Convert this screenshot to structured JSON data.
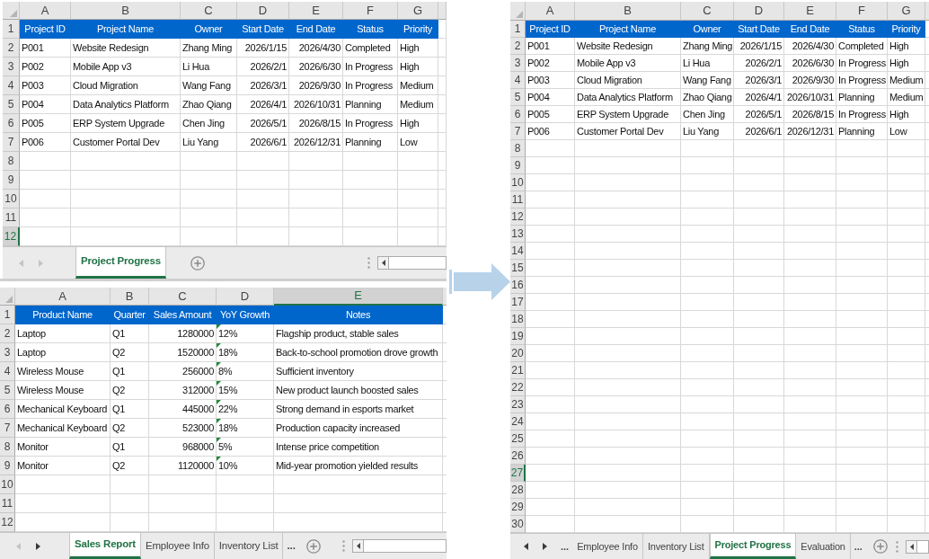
{
  "left_panels": [
    {
      "columns": [
        {
          "label": "A",
          "kind": "text",
          "selected": false
        },
        {
          "label": "B",
          "kind": "text",
          "selected": false
        },
        {
          "label": "C",
          "kind": "text",
          "selected": false
        },
        {
          "label": "D",
          "kind": "number",
          "selected": false
        },
        {
          "label": "E",
          "kind": "number",
          "selected": false
        },
        {
          "label": "F",
          "kind": "text",
          "selected": false
        },
        {
          "label": "G",
          "kind": "text",
          "selected": false
        }
      ],
      "rows": [
        {
          "label": "1",
          "kind": "header",
          "selected": false,
          "cells": [
            "Project ID",
            "Project Name",
            "Owner",
            "Start Date",
            "End Date",
            "Status",
            "Priority"
          ]
        },
        {
          "label": "2",
          "kind": "data",
          "selected": false,
          "cells": [
            "P001",
            "Website Redesign",
            "Zhang Ming",
            "2026/1/15",
            "2026/4/30",
            "Completed",
            "High"
          ]
        },
        {
          "label": "3",
          "kind": "data",
          "selected": false,
          "cells": [
            "P002",
            "Mobile App v3",
            "Li Hua",
            "2026/2/1",
            "2026/6/30",
            "In Progress",
            "High"
          ]
        },
        {
          "label": "4",
          "kind": "data",
          "selected": false,
          "cells": [
            "P003",
            "Cloud Migration",
            "Wang Fang",
            "2026/3/1",
            "2026/9/30",
            "In Progress",
            "Medium"
          ]
        },
        {
          "label": "5",
          "kind": "data",
          "selected": false,
          "cells": [
            "P004",
            "Data Analytics Platform",
            "Zhao Qiang",
            "2026/4/1",
            "2026/10/31",
            "Planning",
            "Medium"
          ]
        },
        {
          "label": "6",
          "kind": "data",
          "selected": false,
          "cells": [
            "P005",
            "ERP System Upgrade",
            "Chen Jing",
            "2026/5/1",
            "2026/8/15",
            "In Progress",
            "High"
          ]
        },
        {
          "label": "7",
          "kind": "data",
          "selected": false,
          "cells": [
            "P006",
            "Customer Portal Dev",
            "Liu Yang",
            "2026/6/1",
            "2026/12/31",
            "Planning",
            "Low"
          ]
        },
        {
          "label": "8",
          "kind": "data",
          "selected": false
        },
        {
          "label": "9",
          "kind": "data",
          "selected": false
        },
        {
          "label": "10",
          "kind": "data",
          "selected": false
        },
        {
          "label": "11",
          "kind": "data",
          "selected": false
        },
        {
          "label": "12",
          "kind": "data",
          "selected": true
        }
      ],
      "tab_bar": {
        "scroll_left": {
          "disabled": true
        },
        "scroll_right": {
          "disabled": true
        },
        "items": [
          {
            "kind": "tab",
            "label": "Project Progress",
            "selected": true
          }
        ]
      }
    },
    {
      "columns": [
        {
          "label": "A",
          "kind": "text",
          "selected": false
        },
        {
          "label": "B",
          "kind": "text",
          "selected": false
        },
        {
          "label": "C",
          "kind": "number",
          "selected": false
        },
        {
          "label": "D",
          "kind": "text",
          "selected": false
        },
        {
          "label": "E",
          "kind": "text",
          "selected": true
        }
      ],
      "rows": [
        {
          "label": "1",
          "kind": "header",
          "selected": false,
          "cells": [
            "Product Name",
            "Quarter",
            "Sales Amount",
            "YoY Growth",
            "Notes"
          ]
        },
        {
          "label": "2",
          "kind": "data",
          "selected": false,
          "cells": [
            "Laptop",
            "Q1",
            "1280000",
            {
              "text": "12%",
              "flagged": true
            },
            "Flagship product, stable sales"
          ]
        },
        {
          "label": "3",
          "kind": "data",
          "selected": false,
          "cells": [
            "Laptop",
            "Q2",
            "1520000",
            {
              "text": "18%",
              "flagged": true
            },
            "Back-to-school promotion drove growth"
          ]
        },
        {
          "label": "4",
          "kind": "data",
          "selected": false,
          "cells": [
            "Wireless Mouse",
            "Q1",
            "256000",
            {
              "text": "8%",
              "flagged": true
            },
            "Sufficient inventory"
          ]
        },
        {
          "label": "5",
          "kind": "data",
          "selected": false,
          "cells": [
            "Wireless Mouse",
            "Q2",
            "312000",
            {
              "text": "15%",
              "flagged": true
            },
            "New product launch boosted sales"
          ]
        },
        {
          "label": "6",
          "kind": "data",
          "selected": false,
          "cells": [
            "Mechanical Keyboard",
            "Q1",
            "445000",
            {
              "text": "22%",
              "flagged": true
            },
            "Strong demand in esports market"
          ]
        },
        {
          "label": "7",
          "kind": "data",
          "selected": false,
          "cells": [
            "Mechanical Keyboard",
            "Q2",
            "523000",
            {
              "text": "18%",
              "flagged": true
            },
            "Production capacity increased"
          ]
        },
        {
          "label": "8",
          "kind": "data",
          "selected": false,
          "cells": [
            "Monitor",
            "Q1",
            "968000",
            {
              "text": "5%",
              "flagged": true
            },
            "Intense price competition"
          ]
        },
        {
          "label": "9",
          "kind": "data",
          "selected": false,
          "cells": [
            "Monitor",
            "Q2",
            "1120000",
            {
              "text": "10%",
              "flagged": true
            },
            "Mid-year promotion yielded results"
          ]
        },
        {
          "label": "10",
          "kind": "data",
          "selected": false
        },
        {
          "label": "11",
          "kind": "data",
          "selected": false
        },
        {
          "label": "12",
          "kind": "data",
          "selected": false
        }
      ],
      "tab_bar": {
        "scroll_left": {
          "disabled": true
        },
        "scroll_right": {
          "disabled": false
        },
        "items": [
          {
            "kind": "tab",
            "label": "Sales Report",
            "selected": true
          },
          {
            "kind": "tab",
            "label": "Employee Info",
            "selected": false
          },
          {
            "kind": "tab",
            "label": "Inventory List",
            "selected": false
          },
          {
            "kind": "more",
            "label": "...",
            "selected": false
          }
        ]
      }
    }
  ],
  "right_panel": {
    "columns": [
      {
        "label": "A",
        "kind": "text",
        "selected": false
      },
      {
        "label": "B",
        "kind": "text",
        "selected": false
      },
      {
        "label": "C",
        "kind": "text",
        "selected": false
      },
      {
        "label": "D",
        "kind": "number",
        "selected": false
      },
      {
        "label": "E",
        "kind": "number",
        "selected": false
      },
      {
        "label": "F",
        "kind": "text",
        "selected": false
      },
      {
        "label": "G",
        "kind": "text",
        "selected": false
      }
    ],
    "rows": [
      {
        "label": "1",
        "kind": "header",
        "selected": false,
        "cells": [
          "Project ID",
          "Project Name",
          "Owner",
          "Start Date",
          "End Date",
          "Status",
          "Priority"
        ]
      },
      {
        "label": "2",
        "kind": "data",
        "selected": false,
        "cells": [
          "P001",
          "Website Redesign",
          "Zhang Ming",
          "2026/1/15",
          "2026/4/30",
          "Completed",
          "High"
        ]
      },
      {
        "label": "3",
        "kind": "data",
        "selected": false,
        "cells": [
          "P002",
          "Mobile App v3",
          "Li Hua",
          "2026/2/1",
          "2026/6/30",
          "In Progress",
          "High"
        ]
      },
      {
        "label": "4",
        "kind": "data",
        "selected": false,
        "cells": [
          "P003",
          "Cloud Migration",
          "Wang Fang",
          "2026/3/1",
          "2026/9/30",
          "In Progress",
          "Medium"
        ]
      },
      {
        "label": "5",
        "kind": "data",
        "selected": false,
        "cells": [
          "P004",
          "Data Analytics Platform",
          "Zhao Qiang",
          "2026/4/1",
          "2026/10/31",
          "Planning",
          "Medium"
        ]
      },
      {
        "label": "6",
        "kind": "data",
        "selected": false,
        "cells": [
          "P005",
          "ERP System Upgrade",
          "Chen Jing",
          "2026/5/1",
          "2026/8/15",
          "In Progress",
          "High"
        ]
      },
      {
        "label": "7",
        "kind": "data",
        "selected": false,
        "cells": [
          "P006",
          "Customer Portal Dev",
          "Liu Yang",
          "2026/6/1",
          "2026/12/31",
          "Planning",
          "Low"
        ]
      },
      {
        "label": "8",
        "kind": "data",
        "selected": false
      },
      {
        "label": "9",
        "kind": "data",
        "selected": false
      },
      {
        "label": "10",
        "kind": "data",
        "selected": false
      },
      {
        "label": "11",
        "kind": "data",
        "selected": false
      },
      {
        "label": "12",
        "kind": "data",
        "selected": false
      },
      {
        "label": "13",
        "kind": "data",
        "selected": false
      },
      {
        "label": "14",
        "kind": "data",
        "selected": false
      },
      {
        "label": "15",
        "kind": "data",
        "selected": false
      },
      {
        "label": "16",
        "kind": "data",
        "selected": false
      },
      {
        "label": "17",
        "kind": "data",
        "selected": false
      },
      {
        "label": "18",
        "kind": "data",
        "selected": false
      },
      {
        "label": "19",
        "kind": "data",
        "selected": false
      },
      {
        "label": "20",
        "kind": "data",
        "selected": false
      },
      {
        "label": "21",
        "kind": "data",
        "selected": false
      },
      {
        "label": "22",
        "kind": "data",
        "selected": false
      },
      {
        "label": "23",
        "kind": "data",
        "selected": false
      },
      {
        "label": "24",
        "kind": "data",
        "selected": false
      },
      {
        "label": "25",
        "kind": "data",
        "selected": false
      },
      {
        "label": "26",
        "kind": "data",
        "selected": false
      },
      {
        "label": "27",
        "kind": "data",
        "selected": true
      },
      {
        "label": "28",
        "kind": "data",
        "selected": false
      },
      {
        "label": "29",
        "kind": "data",
        "selected": false
      },
      {
        "label": "30",
        "kind": "data",
        "selected": false
      }
    ],
    "tab_bar": {
      "scroll_left": {
        "disabled": false
      },
      "scroll_right": {
        "disabled": false
      },
      "items": [
        {
          "kind": "more",
          "label": "...",
          "selected": false
        },
        {
          "kind": "tab",
          "label": "Employee Info",
          "selected": false
        },
        {
          "kind": "tab",
          "label": "Inventory List",
          "selected": false
        },
        {
          "kind": "tab",
          "label": "Project Progress",
          "selected": true
        },
        {
          "kind": "tab",
          "label": "Evaluation",
          "selected": false
        },
        {
          "kind": "more",
          "label": "...",
          "selected": false
        }
      ]
    }
  }
}
